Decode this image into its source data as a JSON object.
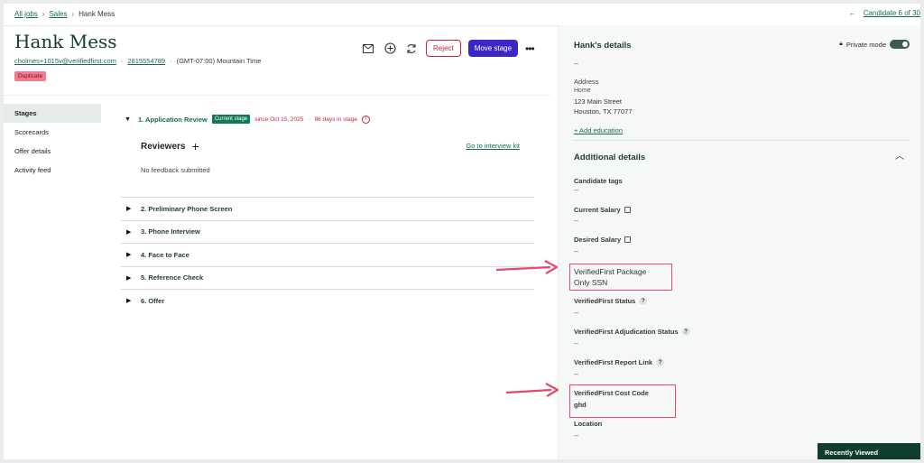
{
  "breadcrumb": {
    "all_jobs": "All jobs",
    "sales": "Sales",
    "current": "Hank Mess",
    "sep": ">"
  },
  "candidate_nav": {
    "back_arrow": "←",
    "label": "Candidate 6 of 30"
  },
  "candidate": {
    "name": "Hank Mess",
    "email": "cholmes+1015v@verifiedfirst.com",
    "phone": "2815554789",
    "timezone": "(GMT-07:00) Mountain Time",
    "separator": "·",
    "duplicate_badge": "Duplicate"
  },
  "actions": {
    "mail_icon": "mail-icon",
    "add_icon": "plus-circle-icon",
    "refresh_icon": "refresh-icon",
    "reject": "Reject",
    "move_stage": "Move stage",
    "more": "•••"
  },
  "sidenav": [
    "Stages",
    "Scorecards",
    "Offer details",
    "Activity feed"
  ],
  "stages": {
    "open": {
      "title": "1. Application Review",
      "badge": "Current stage",
      "since": "since Oct 15, 2025",
      "days": "96 days in stage"
    },
    "reviewers_label": "Reviewers",
    "interview_kit": "Go to interview kit",
    "no_feedback": "No feedback submitted",
    "list": [
      "2. Preliminary Phone Screen",
      "3. Phone Interview",
      "4. Face to Face",
      "5. Reference Check",
      "6. Offer"
    ]
  },
  "details": {
    "title": "Hank's details",
    "private_mode": "Private mode",
    "dash": "--",
    "address_label": "Address",
    "address_type": "Home",
    "address_line1": "123 Main Street",
    "address_line2": "Houston, TX 77077",
    "add_education": "+ Add education"
  },
  "additional": {
    "title": "Additional details",
    "candidate_tags": "Candidate tags",
    "current_salary": "Current Salary",
    "desired_salary": "Desired Salary",
    "vf_package_label": "VerifiedFirst Package",
    "vf_package_value": "Only SSN",
    "vf_status": "VerifiedFirst Status",
    "vf_adjudication": "VerifiedFirst Adjudication Status",
    "vf_report_link": "VerifiedFirst Report Link",
    "vf_cost_code": "VerifiedFirst Cost Code",
    "vf_cost_code_value": "ghd",
    "location": "Location",
    "empty": "--"
  },
  "recently_viewed": "Recently Viewed",
  "colors": {
    "brand_green": "#0f3d2e",
    "link_green": "#1a6b4f",
    "reject_red": "#c8243e",
    "move_purple": "#3b27c9",
    "annotation_pink": "#e8486a"
  }
}
